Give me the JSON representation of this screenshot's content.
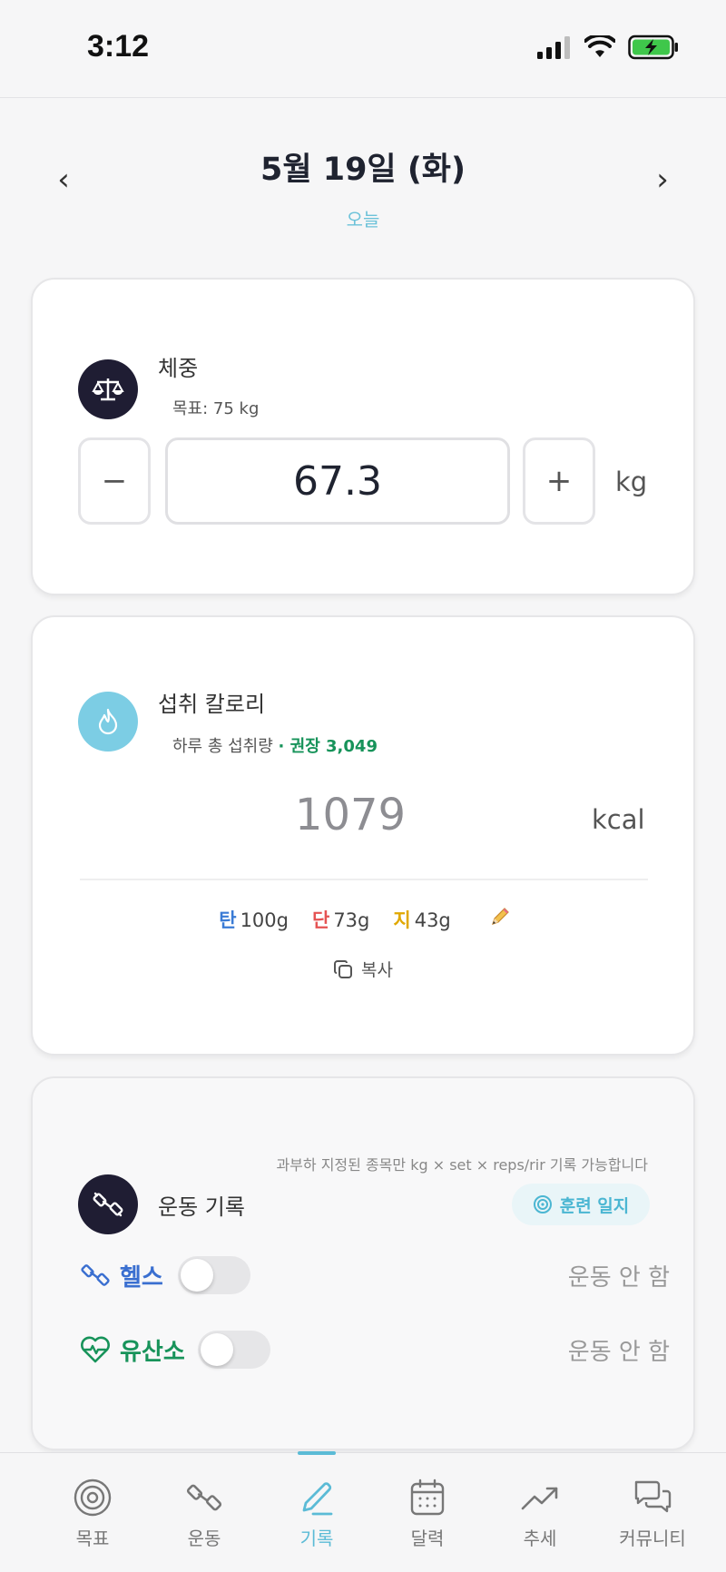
{
  "status_bar": {
    "time": "3:12"
  },
  "date_nav": {
    "title": "5월 19일 (화)",
    "subtitle": "오늘",
    "prev": "‹",
    "next": "›"
  },
  "weight": {
    "title": "체중",
    "goal": "목표: 75 kg",
    "value": "67.3",
    "unit": "kg",
    "minus": "−",
    "plus": "+"
  },
  "calorie": {
    "title": "섭취 칼로리",
    "subtitle": "하루 총 섭취량",
    "recommended": "· 권장 3,049",
    "value": "1079",
    "unit": "kcal",
    "macros": [
      {
        "key": "탄",
        "value": "100g",
        "color": "#3a7bd5"
      },
      {
        "key": "단",
        "value": "73g",
        "color": "#e55353"
      },
      {
        "key": "지",
        "value": "43g",
        "color": "#e0a800"
      }
    ],
    "copy_label": "복사"
  },
  "workout": {
    "title": "운동 기록",
    "note": "과부하 지정된 종목만 kg × set × reps/rir 기록 가능합니다",
    "journal_button": "훈련 일지",
    "rows": [
      {
        "label": "헬스",
        "status": "운동 안 함",
        "color": "#3a6fd0",
        "enabled": false
      },
      {
        "label": "유산소",
        "status": "운동 안 함",
        "color": "#17935a",
        "enabled": false
      }
    ]
  },
  "tabs": [
    {
      "label": "목표",
      "icon": "target-icon",
      "active": false
    },
    {
      "label": "운동",
      "icon": "dumbbell-icon",
      "active": false
    },
    {
      "label": "기록",
      "icon": "pencil-icon",
      "active": true
    },
    {
      "label": "달력",
      "icon": "calendar-icon",
      "active": false
    },
    {
      "label": "추세",
      "icon": "trend-icon",
      "active": false
    },
    {
      "label": "커뮤니티",
      "icon": "chat-icon",
      "active": false
    }
  ]
}
